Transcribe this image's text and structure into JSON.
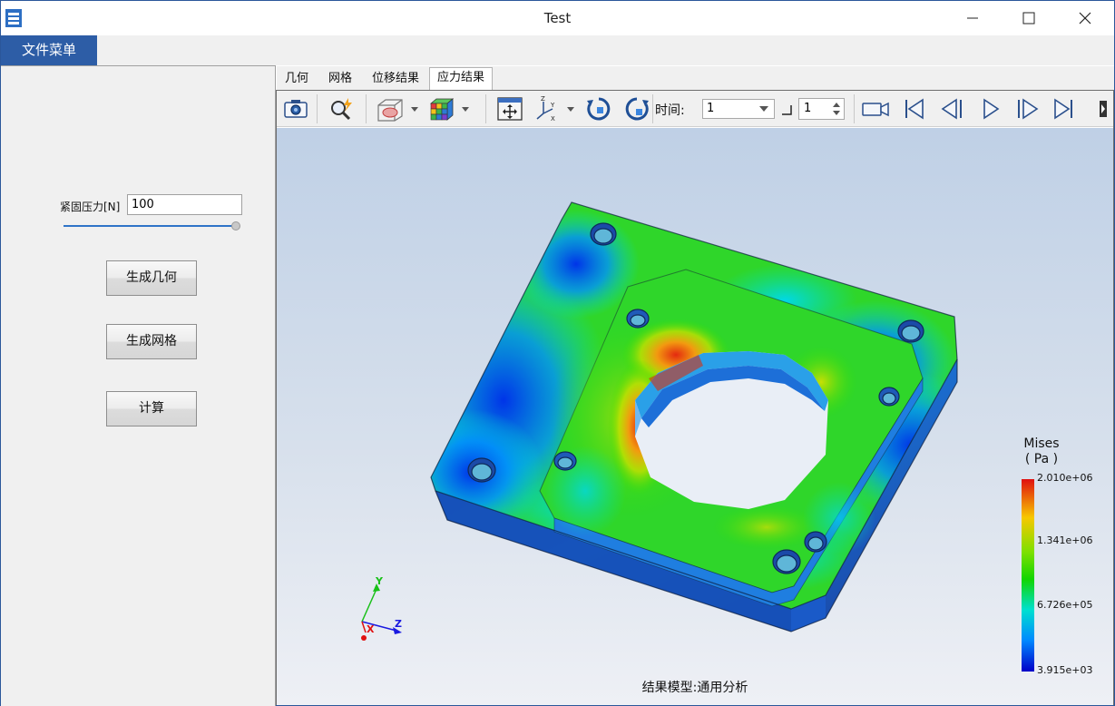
{
  "window": {
    "title": "Test"
  },
  "menu": {
    "file_label": "文件菜单"
  },
  "left_panel": {
    "pressure_label": "紧固压力[N]",
    "pressure_value": "100",
    "buttons": [
      "生成几何",
      "生成网格",
      "计算"
    ]
  },
  "tabs": [
    {
      "label": "几何"
    },
    {
      "label": "网格"
    },
    {
      "label": "位移结果"
    },
    {
      "label": "应力结果",
      "active": true
    }
  ],
  "toolbar": {
    "time_label": "时间:",
    "time_value": "1",
    "step_value": "1",
    "icons": [
      "camera-icon",
      "zoom-icon",
      "section-view-icon",
      "color-cube-icon",
      "fit-view-icon",
      "axes-icon",
      "rotate-left-icon",
      "rotate-right-icon",
      "record-icon",
      "first-frame-icon",
      "previous-frame-icon",
      "play-icon",
      "next-frame-icon",
      "last-frame-icon"
    ]
  },
  "legend": {
    "title": "Mises",
    "unit": "( Pa )",
    "ticks": [
      "2.010e+06",
      "1.341e+06",
      "6.726e+05",
      "3.915e+03"
    ]
  },
  "axes": {
    "x": "X",
    "y": "Y",
    "z": "Z"
  },
  "caption": "结果模型:通用分析",
  "colors": {
    "menu_accent": "#2d5da6",
    "slider": "#2f74c8"
  }
}
